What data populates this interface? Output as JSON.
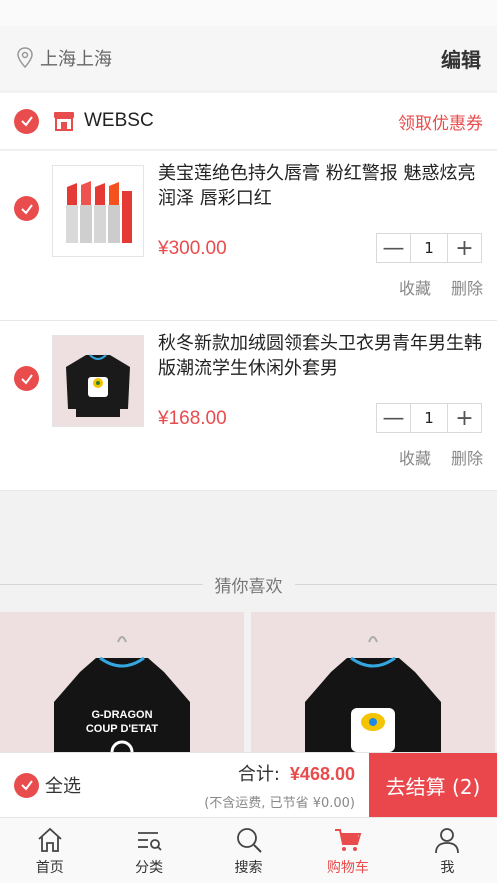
{
  "location": {
    "text": "上海上海",
    "icon": "location-pin-icon"
  },
  "header": {
    "edit_label": "编辑"
  },
  "shop": {
    "name": "WEBSC",
    "coupon_label": "领取优惠券",
    "icon": "store-icon"
  },
  "items": [
    {
      "title": "美宝莲绝色持久唇膏 粉红警报 魅惑炫亮润泽 唇彩口红",
      "price": "¥300.00",
      "qty": "1",
      "fav": "收藏",
      "del": "删除"
    },
    {
      "title": "秋冬新款加绒圆领套头卫衣男青年男生韩版潮流学生休闲外套男",
      "price": "¥168.00",
      "qty": "1",
      "fav": "收藏",
      "del": "删除"
    }
  ],
  "recommend": {
    "title": "猜你喜欢",
    "left_print": [
      "G-DRAGON",
      "COUP D'ETAT"
    ]
  },
  "footer": {
    "select_all": "全选",
    "total_label": "合计:",
    "total_amount": "¥468.00",
    "note": "(不含运费, 已节省 ¥0.00)",
    "checkout": "去结算 (2)"
  },
  "tabs": [
    {
      "label": "首页",
      "icon": "home-icon"
    },
    {
      "label": "分类",
      "icon": "category-icon"
    },
    {
      "label": "搜索",
      "icon": "search-icon"
    },
    {
      "label": "购物车",
      "icon": "cart-icon",
      "active": true
    },
    {
      "label": "我",
      "icon": "user-icon"
    }
  ],
  "colors": {
    "accent": "#e94c4c"
  }
}
